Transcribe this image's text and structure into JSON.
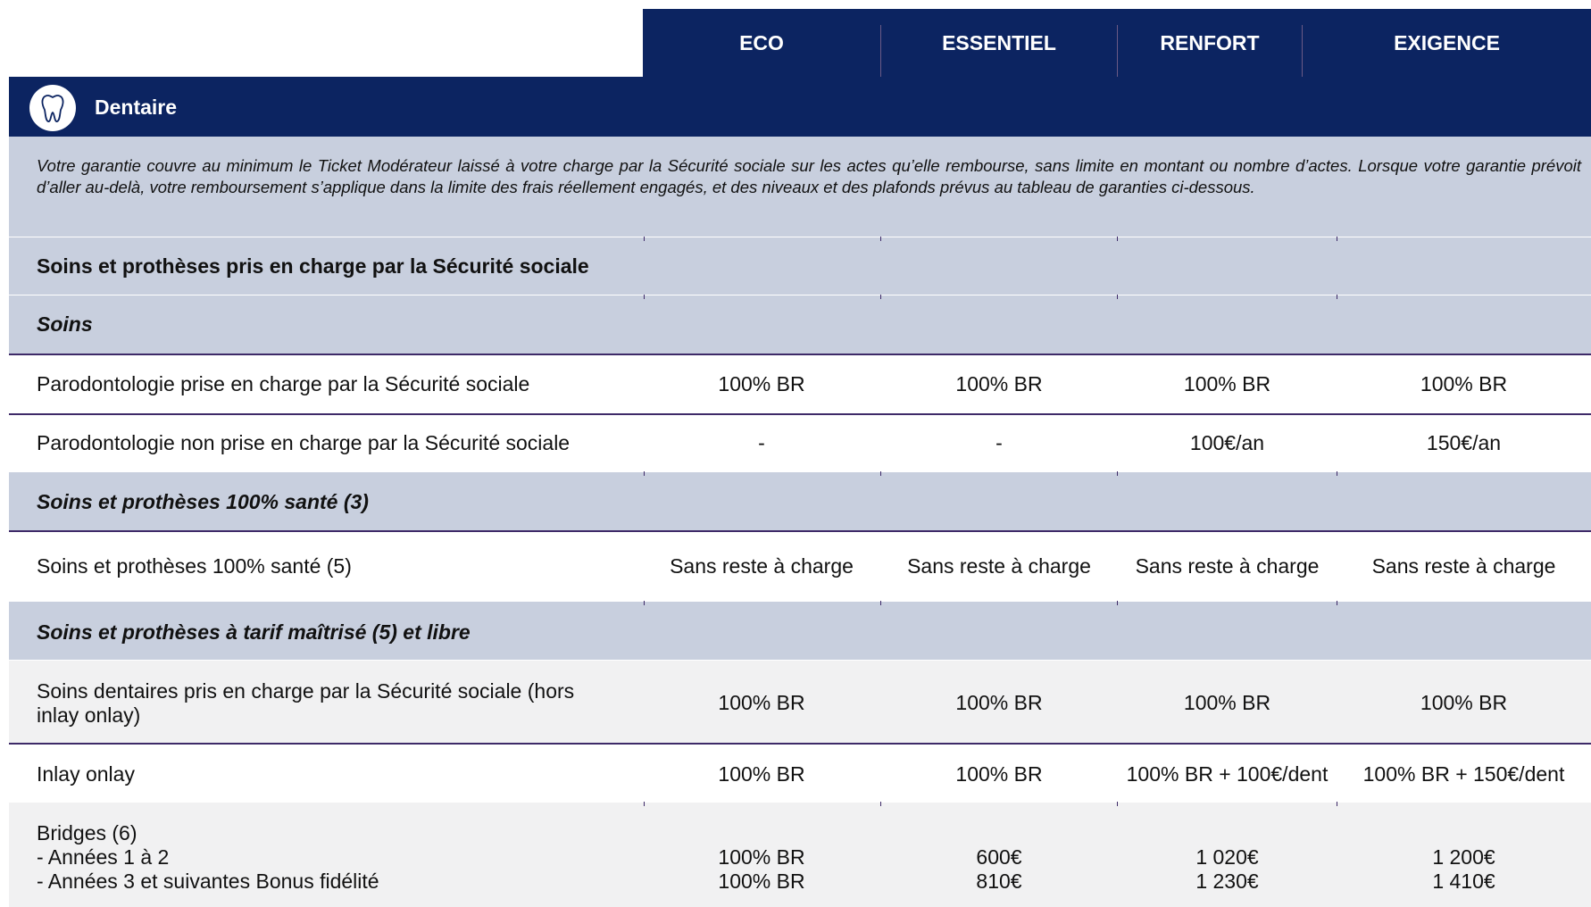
{
  "plans": [
    "ECO",
    "ESSENTIEL",
    "RENFORT",
    "EXIGENCE"
  ],
  "section": {
    "title": "Dentaire",
    "icon": "tooth-icon",
    "intro": "Votre garantie couvre au minimum le Ticket Modérateur laissé à votre charge par la Sécurité sociale sur les actes qu’elle rembourse, sans limite en montant ou nombre d’actes. Lorsque votre garantie prévoit d’aller au-delà, votre remboursement s’applique dans la limite des frais réellement engagés, et des niveaux et des plafonds prévus au tableau de garanties ci-dessous."
  },
  "subheading": "Soins et prothèses pris en charge par la Sécurité sociale",
  "categories": {
    "soins": "Soins",
    "sante100": "Soins et prothèses 100% santé (3)",
    "maitrise": "Soins et prothèses à tarif maîtrisé (5) et libre"
  },
  "rows": {
    "paro_pc": {
      "label": "Parodontologie prise en charge par la Sécurité sociale",
      "values": [
        "100% BR",
        "100% BR",
        "100% BR",
        "100% BR"
      ]
    },
    "paro_npc": {
      "label": "Parodontologie non prise en charge par la Sécurité sociale",
      "values": [
        "-",
        "-",
        "100€/an",
        "150€/an"
      ]
    },
    "sante100": {
      "label": "Soins et prothèses 100% santé (5)",
      "values": [
        "Sans reste à charge",
        "Sans reste à charge",
        "Sans reste à charge",
        "Sans reste à charge"
      ]
    },
    "soins_dent": {
      "label_line1": "Soins dentaires pris en charge par la Sécurité sociale (hors",
      "label_line2": "inlay onlay)",
      "values": [
        "100% BR",
        "100% BR",
        "100% BR",
        "100% BR"
      ]
    },
    "inlay": {
      "label": "Inlay onlay",
      "values": [
        "100% BR",
        "100% BR",
        "100% BR + 100€/dent",
        "100% BR + 150€/dent"
      ]
    },
    "bridges": {
      "label_line1": "Bridges (6)",
      "label_line2": "- Années 1 à 2",
      "label_line3": "- Années 3 et suivantes Bonus fidélité",
      "values_y1": [
        "100% BR",
        "600€",
        "1 020€",
        "1 200€"
      ],
      "values_y3": [
        "100% BR",
        "810€",
        "1 230€",
        "1 410€"
      ]
    }
  },
  "colors": {
    "navy": "#0c2461",
    "band_gray": "#c8cfde",
    "row_light": "#f1f1f2",
    "rule": "#3e2a68"
  }
}
